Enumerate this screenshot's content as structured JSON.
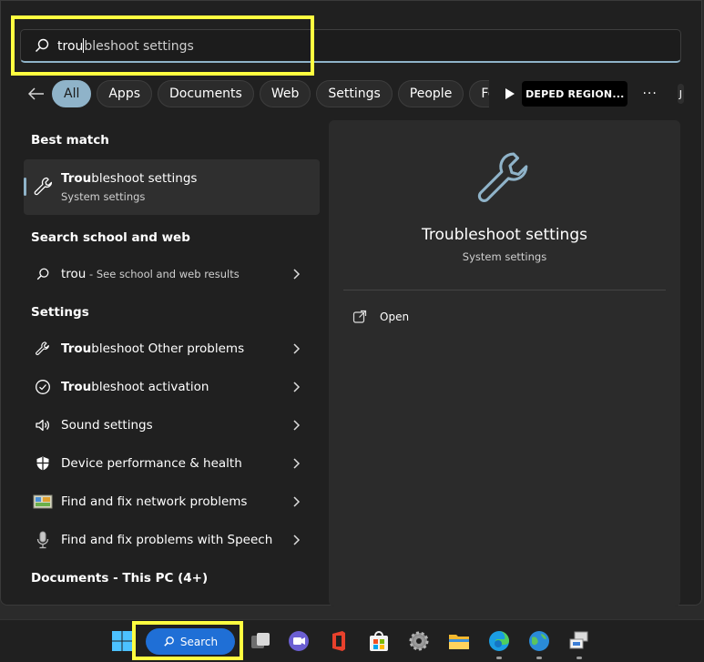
{
  "search": {
    "typed": "trou",
    "rest": "bleshoot settings"
  },
  "filters": {
    "items": [
      "All",
      "Apps",
      "Documents",
      "Web",
      "Settings",
      "People",
      "Folders"
    ],
    "active": "All",
    "org": "DEPED REGION...",
    "more": "···",
    "avatar": "J"
  },
  "sections": {
    "best_match": "Best match",
    "web": "Search school and web",
    "settings": "Settings",
    "documents": "Documents - This PC (4+)"
  },
  "best_match": {
    "title_bold": "Trou",
    "title_rest": "bleshoot settings",
    "subtitle": "System settings",
    "icon": "wrench-icon"
  },
  "web_result": {
    "query": "trou",
    "suffix": " - See school and web results",
    "icon": "search-icon"
  },
  "settings_results": [
    {
      "bold": "Trou",
      "rest": "bleshoot Other problems",
      "icon": "wrench-icon"
    },
    {
      "bold": "Trou",
      "rest": "bleshoot activation",
      "icon": "check-circle-icon"
    },
    {
      "bold": "",
      "rest": "Sound settings",
      "icon": "speaker-icon"
    },
    {
      "bold": "",
      "rest": "Device performance & health",
      "icon": "shield-icon"
    },
    {
      "bold": "",
      "rest": "Find and fix network problems",
      "icon": "network-troubleshooter-icon"
    },
    {
      "bold": "",
      "rest": "Find and fix problems with Speech",
      "icon": "microphone-icon"
    }
  ],
  "preview": {
    "title": "Troubleshoot settings",
    "subtitle": "System settings",
    "open_label": "Open",
    "icon": "wrench-icon"
  },
  "taskbar": {
    "search_label": "Search",
    "apps": [
      "start-icon",
      "task-view-icon",
      "teams-chat-icon",
      "office-icon",
      "store-icon",
      "settings-gear-icon",
      "file-explorer-icon",
      "edge-icon",
      "network-globe-icon",
      "remote-desktop-icon"
    ]
  },
  "colors": {
    "accent": "#8fb3c9",
    "highlight": "#ffff40",
    "taskbar_search": "#1f6fd6"
  }
}
